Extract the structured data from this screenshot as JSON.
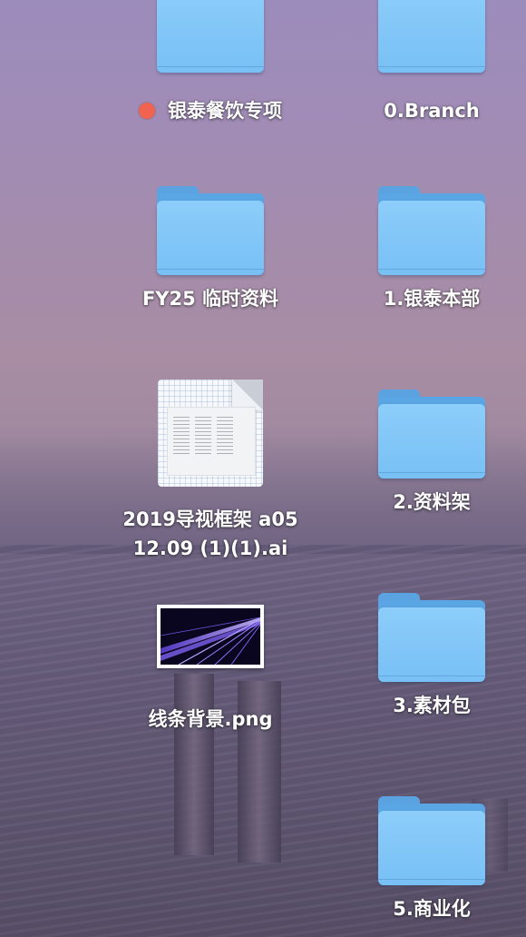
{
  "desktop": {
    "items": [
      {
        "label": "银泰餐饮专项",
        "kind": "folder",
        "tag_color": "#ef6350"
      },
      {
        "label": "0.Branch",
        "kind": "folder"
      },
      {
        "label": "FY25 临时资料",
        "kind": "folder"
      },
      {
        "label": "1.银泰本部",
        "kind": "folder"
      },
      {
        "label_line1": "2019导视框架 a05",
        "label_line2": "12.09 (1)(1).ai",
        "kind": "ai-document"
      },
      {
        "label": "2.资料架",
        "kind": "folder"
      },
      {
        "label": "线条背景.png",
        "kind": "png-image"
      },
      {
        "label": "3.素材包",
        "kind": "folder"
      },
      {
        "label": "5.商业化",
        "kind": "folder"
      }
    ]
  },
  "colors": {
    "folder_front": "#8ccdfa",
    "folder_back": "#5aa5e4",
    "tag_red": "#ef6350",
    "label_text": "#ffffff"
  },
  "icons": {
    "folder": "folder-icon",
    "ai_document": "ai-document-icon",
    "png_image": "image-thumbnail-icon",
    "tag": "red-tag-icon"
  }
}
